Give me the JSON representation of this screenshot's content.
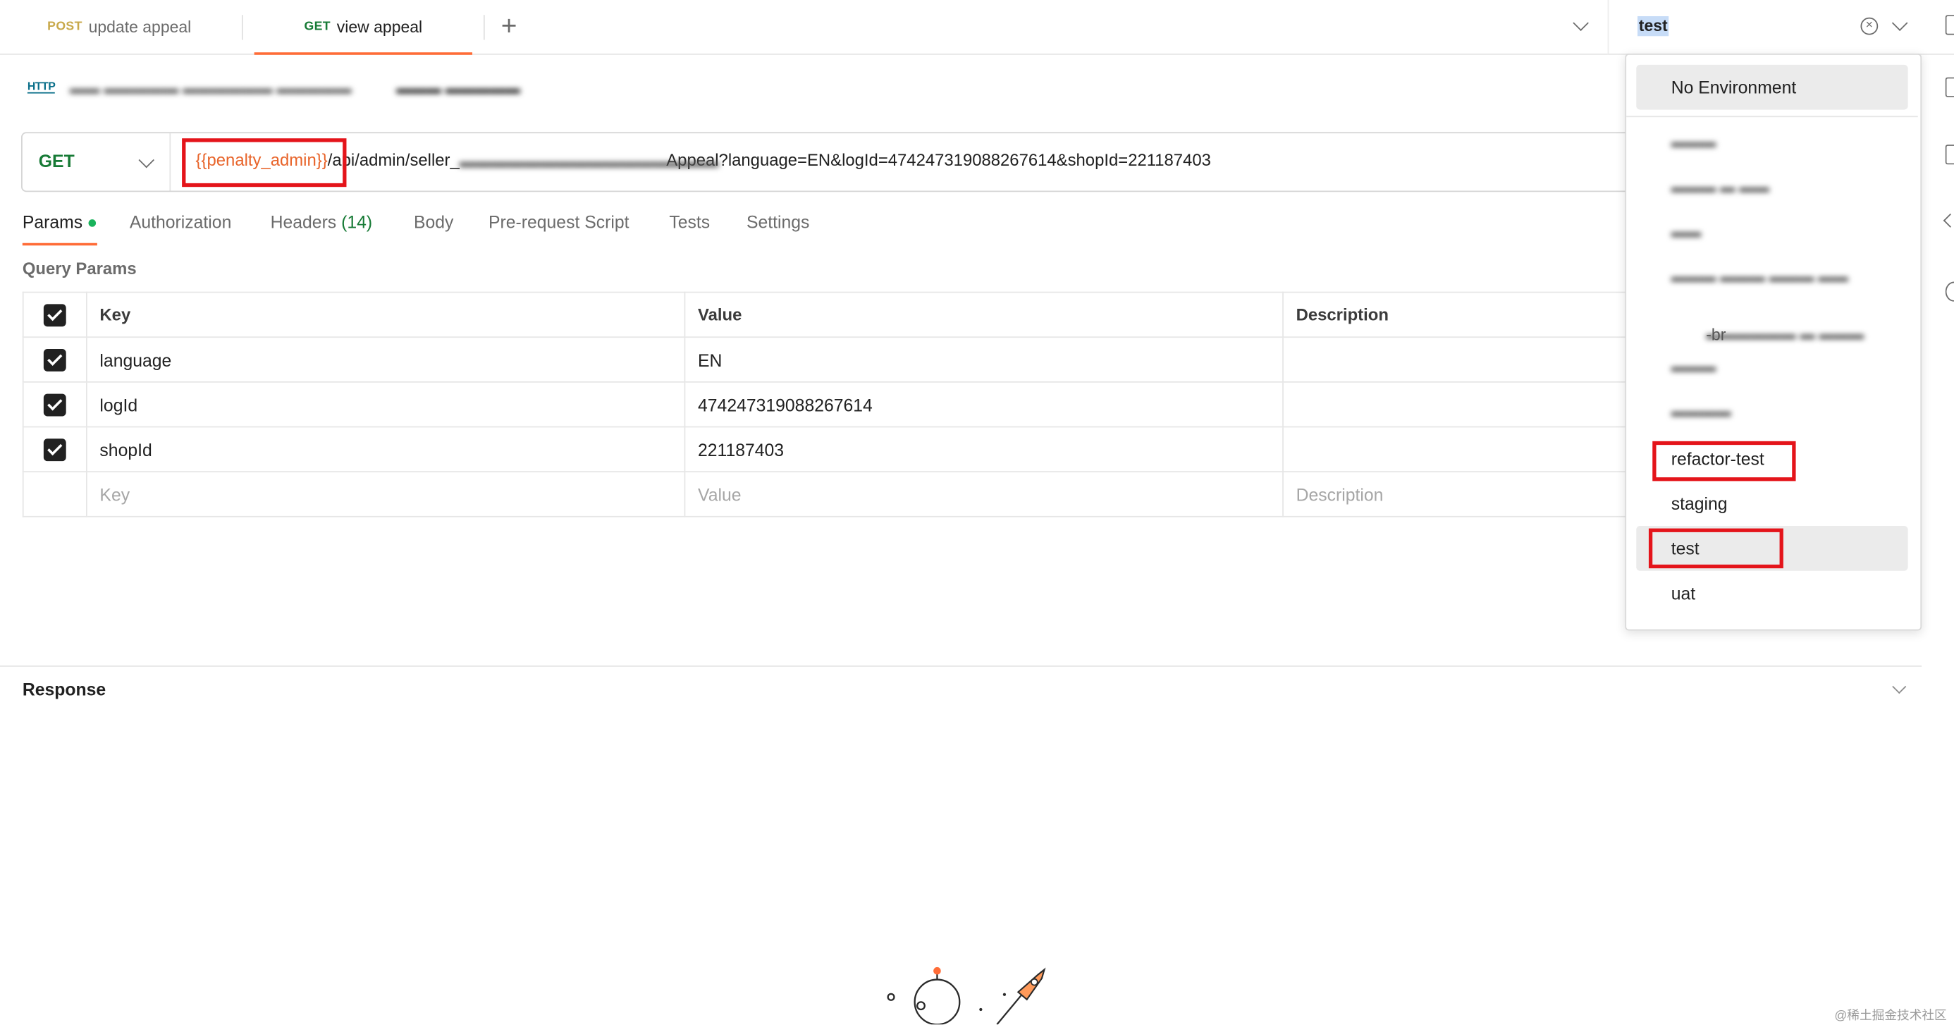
{
  "tabs": [
    {
      "method": "POST",
      "name": "update appeal",
      "active": false
    },
    {
      "method": "GET",
      "name": "view appeal",
      "active": true
    }
  ],
  "environment": {
    "selected": "test",
    "options": [
      {
        "label": "No Environment"
      },
      {
        "label": "refactor-test",
        "highlighted": true
      },
      {
        "label": "staging"
      },
      {
        "label": "test",
        "selected": true,
        "highlighted": true
      },
      {
        "label": "uat"
      }
    ],
    "redacted_suffix": "-br"
  },
  "request": {
    "method": "GET",
    "url_variable": "{{penalty_admin}}",
    "url_path_start": "/api/admin/seller_",
    "url_rest": "Appeal?language=EN&logId=474247319088267614&shopId=221187403"
  },
  "subtabs": {
    "params": "Params",
    "authorization": "Authorization",
    "headers": "Headers",
    "headers_count": "(14)",
    "body": "Body",
    "prerequest": "Pre-request Script",
    "tests": "Tests",
    "settings": "Settings"
  },
  "query_params": {
    "title": "Query Params",
    "columns": {
      "key": "Key",
      "value": "Value",
      "description": "Description"
    },
    "rows": [
      {
        "key": "language",
        "value": "EN"
      },
      {
        "key": "logId",
        "value": "474247319088267614"
      },
      {
        "key": "shopId",
        "value": "221187403"
      }
    ],
    "placeholders": {
      "key": "Key",
      "value": "Value",
      "description": "Description"
    }
  },
  "response": {
    "title": "Response"
  },
  "watermark": "@稀土掘金技术社区",
  "colors": {
    "accent": "#ff6c37",
    "get": "#167a35",
    "post": "#c8a94b",
    "variable": "#e8642a",
    "highlight_box": "#e4141a"
  }
}
